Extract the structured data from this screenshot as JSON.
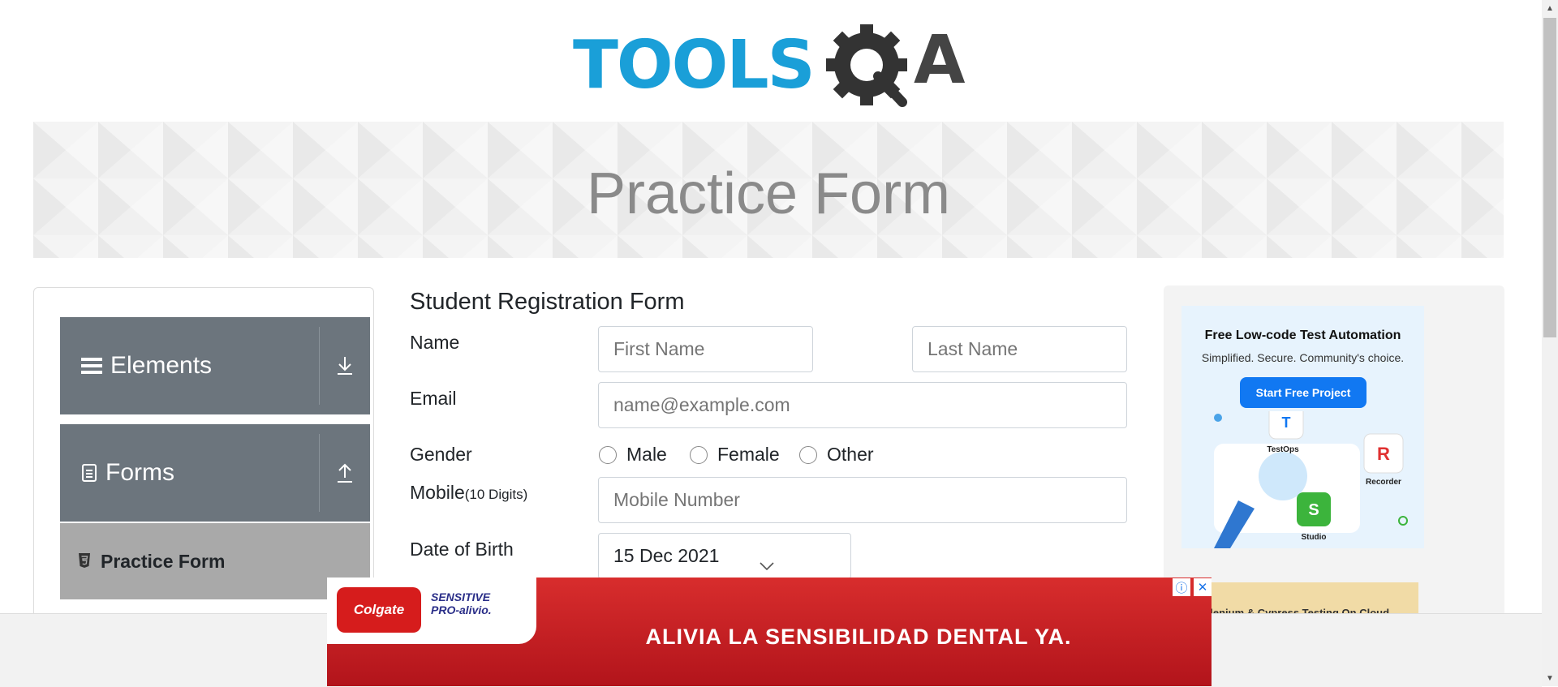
{
  "brand": {
    "logo_text": "TOOLS",
    "logo_suffix": "A"
  },
  "banner": {
    "title": "Practice Form"
  },
  "sidebar": {
    "groups": [
      {
        "label": "Elements",
        "icon": "hamburger-icon",
        "toggle_icon": "download-arrow-icon"
      },
      {
        "label": "Forms",
        "icon": "document-icon",
        "toggle_icon": "upload-arrow-icon"
      }
    ],
    "active_item": {
      "label": "Practice Form",
      "icon": "html5-icon"
    }
  },
  "form": {
    "title": "Student Registration Form",
    "name_label": "Name",
    "first_name_placeholder": "First Name",
    "last_name_placeholder": "Last Name",
    "email_label": "Email",
    "email_placeholder": "name@example.com",
    "gender_label": "Gender",
    "gender_options": [
      "Male",
      "Female",
      "Other"
    ],
    "mobile_label": "Mobile",
    "mobile_hint": "(10 Digits)",
    "mobile_placeholder": "Mobile Number",
    "dob_label": "Date of Birth",
    "dob_value": "15 Dec 2021"
  },
  "right_ad": {
    "title": "Free Low-code Test Automation",
    "subtitle": "Simplified. Secure. Community's choice.",
    "button": "Start Free Project",
    "products": [
      "TestOps",
      "Recorder",
      "Studio"
    ],
    "second_text": "elenium & Cypress Testing On Cloud"
  },
  "bottom_ad": {
    "brand": "Colgate",
    "product_line1": "SENSITIVE",
    "product_line2": "PRO-alivio.",
    "slogan": "ALIVIA LA SENSIBILIDAD DENTAL YA."
  },
  "colors": {
    "brand_blue": "#1a9fd8",
    "sidebar_gray": "#6c757d",
    "active_gray": "#a9a9a9",
    "ad_red": "#c8202a"
  }
}
